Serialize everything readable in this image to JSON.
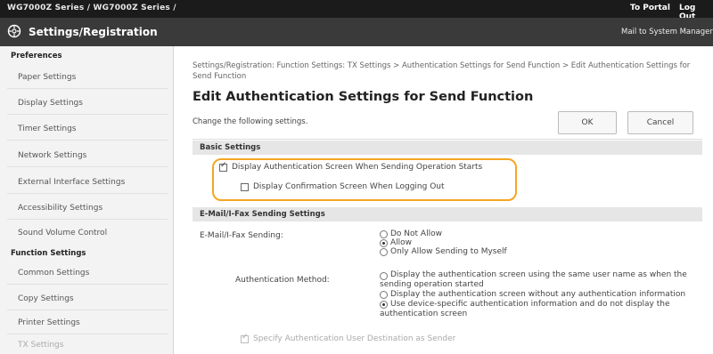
{
  "topbar": {
    "model": "WG7000Z Series / WG7000Z Series /",
    "portal": "To Portal",
    "logout": "Log Out"
  },
  "titlebar": {
    "title": "Settings/Registration",
    "mail": "Mail to System Manager"
  },
  "sidebar": {
    "preferences_header": "Preferences",
    "preferences": [
      "Paper Settings",
      "Display Settings",
      "Timer Settings",
      "Network Settings",
      "External Interface Settings",
      "Accessibility Settings",
      "Sound Volume Control"
    ],
    "function_header": "Function Settings",
    "functions": [
      "Common Settings",
      "Copy Settings",
      "Printer Settings",
      "TX Settings"
    ]
  },
  "main": {
    "breadcrumb": "Settings/Registration: Function Settings: TX Settings > Authentication Settings for Send Function > Edit Authentication Settings for Send Function",
    "heading": "Edit Authentication Settings for Send Function",
    "subheading": "Change the following settings.",
    "ok_label": "OK",
    "cancel_label": "Cancel"
  },
  "basic": {
    "header": "Basic Settings",
    "display_auth_label": "Display Authentication Screen When Sending Operation Starts",
    "display_auth_checked": true,
    "confirm_logout_label": "Display Confirmation Screen When Logging Out",
    "confirm_logout_checked": false
  },
  "email": {
    "header": "E-Mail/I-Fax Sending Settings",
    "sending_label": "E-Mail/I-Fax Sending:",
    "sending_options": [
      "Do Not Allow",
      "Allow",
      "Only Allow Sending to Myself"
    ],
    "sending_selected": "Allow",
    "auth_method_label": "Authentication Method:",
    "auth_options": [
      "Display the authentication screen using the same user name as when the",
      "sending operation started",
      "Display the authentication screen without any authentication information",
      "Use device-specific authentication information and do not display the",
      "authentication screen"
    ],
    "auth_selected_index": 2,
    "specify_label": "Specify Authentication User Destination as Sender",
    "specify_checked": true
  },
  "colors": {
    "highlight": "#f5a623",
    "topbar": "#1b1b1b",
    "titlebar": "#3a3a3a"
  }
}
